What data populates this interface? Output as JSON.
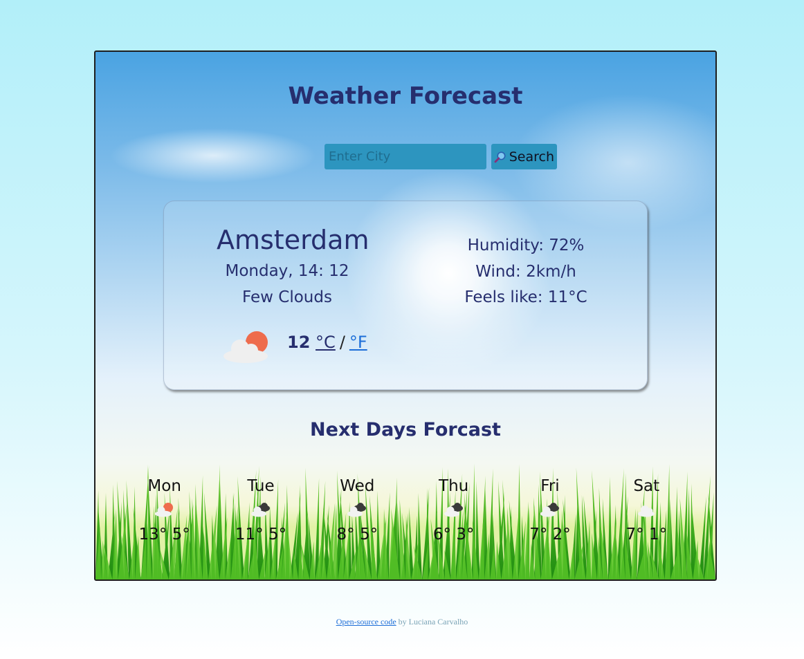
{
  "app": {
    "title": "Weather Forecast"
  },
  "search": {
    "placeholder": "Enter City",
    "button_label": "Search",
    "button_icon": "magnifier-icon"
  },
  "current": {
    "city": "Amsterdam",
    "datetime": "Monday, 14: 12",
    "description": "Few Clouds",
    "icon": "sun-behind-cloud-icon",
    "temperature": "12",
    "unit_celsius": "°C",
    "unit_separator": "/",
    "unit_fahrenheit": "°F",
    "humidity": "Humidity: 72%",
    "wind": "Wind: 2km/h",
    "feels_like": "Feels like: 11°C"
  },
  "forecast": {
    "title": "Next Days Forcast",
    "days": [
      {
        "name": "Mon",
        "temps": "13° 5°",
        "icon": "sun-cloud-icon"
      },
      {
        "name": "Tue",
        "temps": "11° 5°",
        "icon": "broken-clouds-icon"
      },
      {
        "name": "Wed",
        "temps": "8° 5°",
        "icon": "broken-clouds-icon"
      },
      {
        "name": "Thu",
        "temps": "6° 3°",
        "icon": "broken-clouds-icon"
      },
      {
        "name": "Fri",
        "temps": "7° 2°",
        "icon": "broken-clouds-icon"
      },
      {
        "name": "Sat",
        "temps": "7° 1°",
        "icon": "cloud-icon"
      }
    ]
  },
  "footer": {
    "link_text": "Open-source code",
    "author_text": " by Luciana Carvalho"
  },
  "colors": {
    "primary_text": "#262e6e",
    "search_bg": "#2d95bf",
    "link": "#1d6ed8",
    "sun_orange": "#ee6c4d"
  }
}
